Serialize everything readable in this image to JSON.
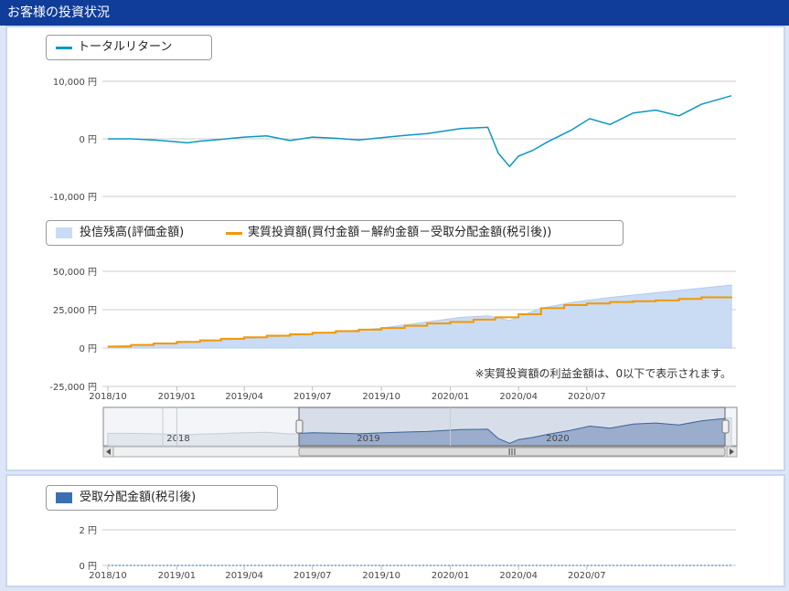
{
  "header": {
    "title": "お客様の投資状況"
  },
  "chart_data": [
    {
      "type": "line",
      "title": "",
      "legend": [
        "トータルリターン"
      ],
      "y_ticks": [
        "10,000 円",
        "0 円",
        "-10,000 円"
      ],
      "ylim": [
        -10000,
        10000
      ],
      "series": [
        {
          "name": "トータルリターン",
          "color": "#0a98c0",
          "x": [
            "2018-10-01",
            "2018-11-01",
            "2018-12-01",
            "2019-01-01",
            "2019-01-15",
            "2019-02-01",
            "2019-03-01",
            "2019-04-01",
            "2019-05-01",
            "2019-06-01",
            "2019-07-01",
            "2019-08-01",
            "2019-09-01",
            "2019-10-01",
            "2019-11-01",
            "2019-12-01",
            "2020-01-15",
            "2020-02-20",
            "2020-03-05",
            "2020-03-20",
            "2020-04-01",
            "2020-04-20",
            "2020-05-10",
            "2020-06-10",
            "2020-07-05",
            "2020-08-01",
            "2020-09-01",
            "2020-10-01",
            "2020-11-01",
            "2020-12-01",
            "2021-01-10"
          ],
          "values": [
            0,
            0,
            -200,
            -500,
            -700,
            -400,
            -100,
            300,
            500,
            -300,
            300,
            100,
            -200,
            200,
            600,
            900,
            1800,
            2000,
            -2500,
            -4800,
            -3000,
            -2000,
            -500,
            1500,
            3500,
            2500,
            4500,
            5000,
            4000,
            6000,
            7500
          ]
        }
      ]
    },
    {
      "type": "area",
      "title": "",
      "legend": [
        "投信残高(評価金額)",
        "実質投資額(買付金額－解約金額－受取分配金額(税引後))"
      ],
      "y_ticks": [
        "50,000 円",
        "25,000 円",
        "0 円",
        "-25,000 円"
      ],
      "ylim": [
        -25000,
        50000
      ],
      "x_ticks": [
        "2018/10",
        "2019/01",
        "2019/04",
        "2019/07",
        "2019/10",
        "2020/01",
        "2020/04",
        "2020/07"
      ],
      "note": "※実質投資額の利益金額は、0以下で表示されます。",
      "series": [
        {
          "name": "投信残高(評価金額)",
          "color": "#c9dcf4",
          "x": [
            "2018-10-01",
            "2018-12-01",
            "2019-02-01",
            "2019-04-01",
            "2019-06-01",
            "2019-08-01",
            "2019-10-01",
            "2019-12-01",
            "2020-01-15",
            "2020-02-20",
            "2020-03-20",
            "2020-05-01",
            "2020-06-15",
            "2020-08-01",
            "2020-10-01",
            "2020-12-01",
            "2021-01-10"
          ],
          "values": [
            1000,
            2500,
            4000,
            6000,
            8000,
            10500,
            13000,
            17000,
            20000,
            21000,
            18000,
            26000,
            30000,
            33000,
            36000,
            39000,
            41000
          ]
        },
        {
          "name": "実質投資額",
          "color": "#f39800",
          "x": [
            "2018-10-01",
            "2018-11-01",
            "2018-12-01",
            "2019-01-01",
            "2019-02-01",
            "2019-03-01",
            "2019-04-01",
            "2019-05-01",
            "2019-06-01",
            "2019-07-01",
            "2019-08-01",
            "2019-09-01",
            "2019-10-01",
            "2019-11-01",
            "2019-12-01",
            "2020-01-01",
            "2020-02-01",
            "2020-03-01",
            "2020-04-01",
            "2020-05-01",
            "2020-06-01",
            "2020-07-01",
            "2020-08-01",
            "2020-09-01",
            "2020-10-01",
            "2020-11-01",
            "2020-12-01",
            "2021-01-10"
          ],
          "values": [
            1000,
            2000,
            3000,
            4000,
            5000,
            6000,
            7000,
            8000,
            9000,
            10000,
            11000,
            12000,
            13000,
            14500,
            16000,
            17000,
            18500,
            20000,
            22000,
            26000,
            28000,
            29000,
            30000,
            30500,
            31000,
            32000,
            33000,
            33500
          ]
        }
      ]
    },
    {
      "type": "line",
      "title": "",
      "legend": [
        "受取分配金額(税引後)"
      ],
      "y_ticks": [
        "2 円",
        "0 円"
      ],
      "ylim": [
        0,
        2
      ],
      "x_ticks": [
        "2018/10",
        "2019/01",
        "2019/04",
        "2019/07",
        "2019/10",
        "2020/01",
        "2020/04",
        "2020/07"
      ],
      "series": [
        {
          "name": "受取分配金額(税引後)",
          "color": "#3a6fb5",
          "x": [
            "2018-10-01",
            "2021-01-10"
          ],
          "values": [
            0,
            0
          ]
        }
      ]
    }
  ],
  "navigator": {
    "year_labels": [
      "2018",
      "2019",
      "2020"
    ],
    "grip": "III"
  },
  "colors": {
    "header": "#0f3d99",
    "return_line": "#0a98c0",
    "balance_area": "#c9dcf4",
    "investment_line": "#f39800",
    "dividend": "#3a6fb5"
  }
}
